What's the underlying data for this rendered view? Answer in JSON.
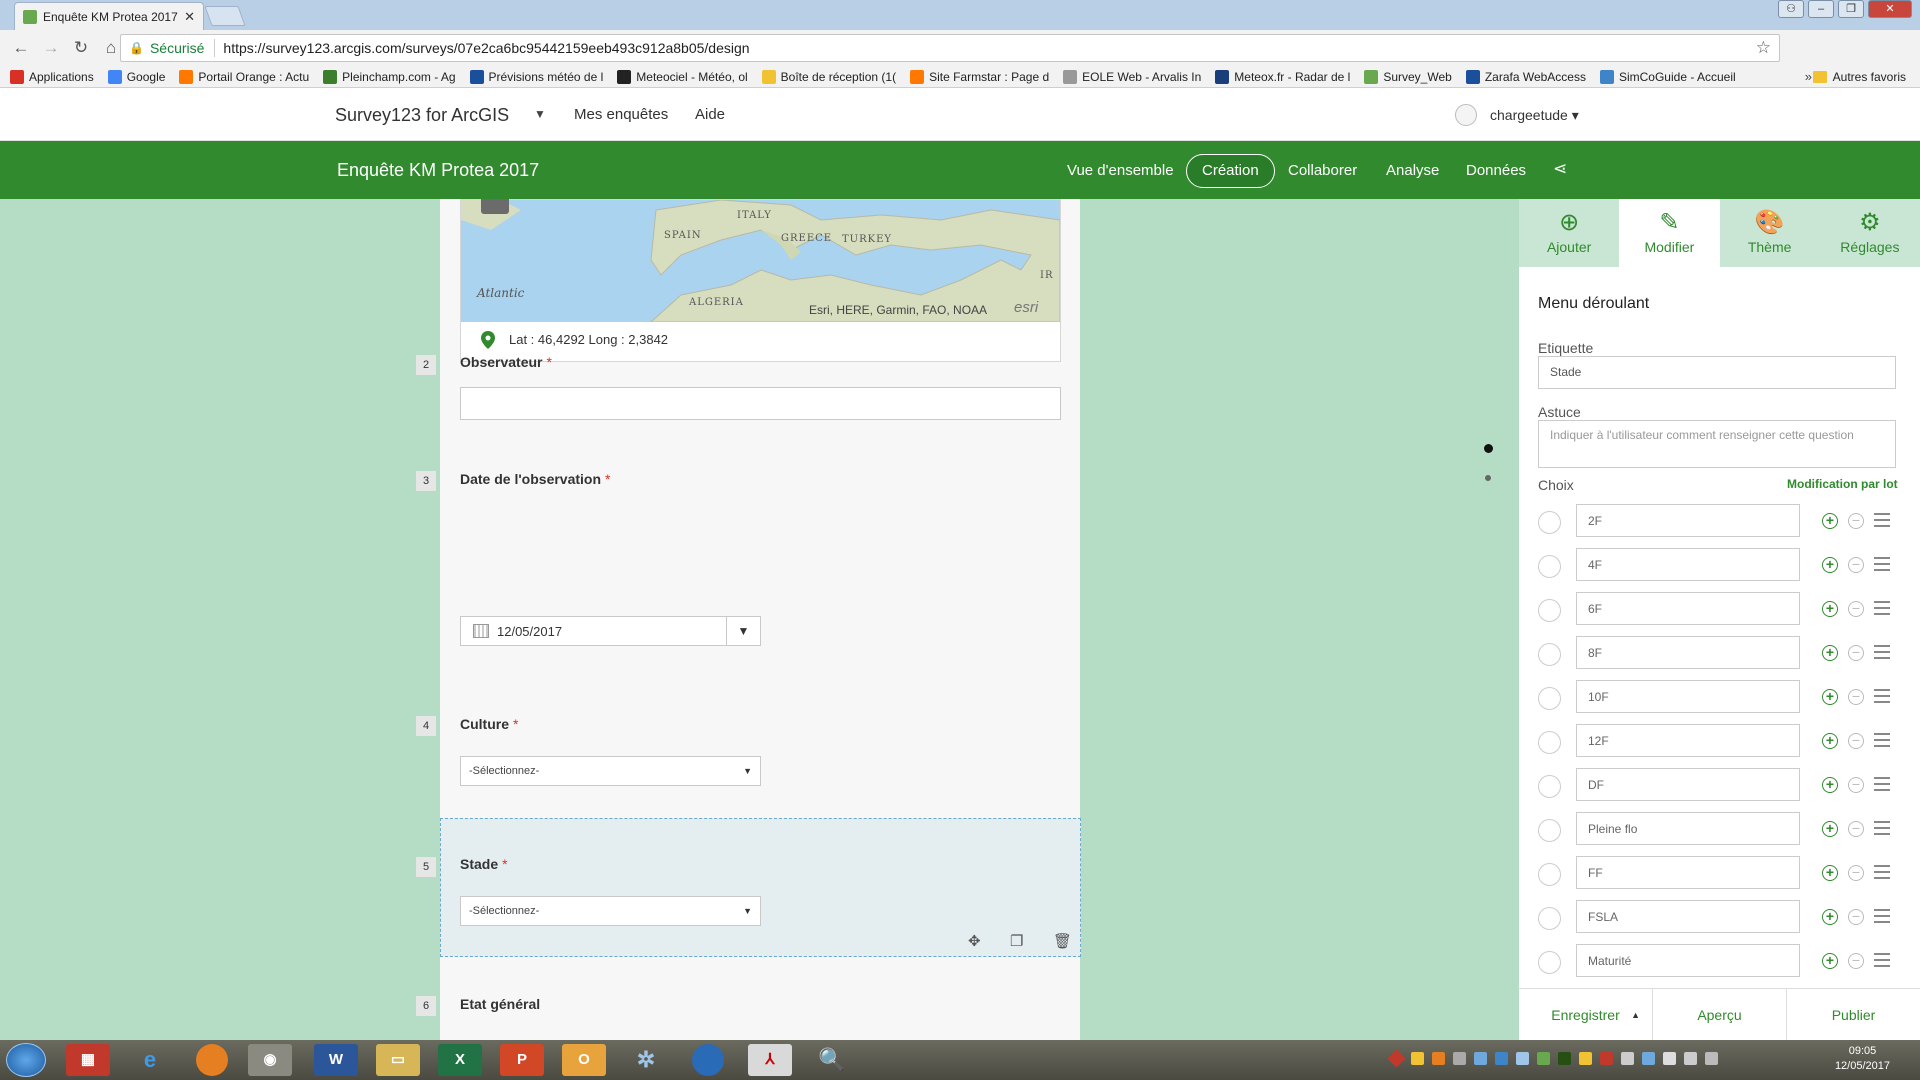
{
  "browser": {
    "tab_title": "Enquête KM Protea 2017",
    "secure_label": "Sécurisé",
    "url": "https://survey123.arcgis.com/surveys/07e2ca6bc95442159eeb493c912a8b05/design",
    "bookmarks": [
      {
        "label": "Applications",
        "color": "#d93025"
      },
      {
        "label": "Google",
        "color": "#4285f4"
      },
      {
        "label": "Portail Orange : Actu",
        "color": "#ff7900"
      },
      {
        "label": "Pleinchamp.com - Ag",
        "color": "#3b7f2d"
      },
      {
        "label": "Prévisions météo de l",
        "color": "#1a4f9c"
      },
      {
        "label": "Meteociel - Météo, ol",
        "color": "#222222"
      },
      {
        "label": "Boîte de réception (1(",
        "color": "#f1c232"
      },
      {
        "label": "Site Farmstar : Page d",
        "color": "#ff7900"
      },
      {
        "label": "EOLE Web - Arvalis In",
        "color": "#999999"
      },
      {
        "label": "Meteox.fr - Radar de l",
        "color": "#1a3e7a"
      },
      {
        "label": "Survey_Web",
        "color": "#6aa84f"
      },
      {
        "label": "Zarafa WebAccess",
        "color": "#1a4f9c"
      },
      {
        "label": "SimCoGuide - Accueil",
        "color": "#3d85c6"
      }
    ],
    "bookmarks_more": "»",
    "other_bookmarks": "Autres favoris"
  },
  "app_header": {
    "brand": "Survey123 for ArcGIS",
    "nav": [
      "Mes enquêtes",
      "Aide"
    ],
    "user": "chargeetude ▾"
  },
  "survey_bar": {
    "title": "Enquête KM Protea 2017",
    "tabs": [
      "Vue d'ensemble",
      "Création",
      "Collaborer",
      "Analyse",
      "Données"
    ],
    "active_tab": "Création"
  },
  "map": {
    "labels": [
      "ITALY",
      "SPAIN",
      "GREECE",
      "TURKEY",
      "Atlantic",
      "IR",
      "ALGERIA"
    ],
    "attribution": "Esri, HERE, Garmin, FAO, NOAA",
    "logo": "esri",
    "coords": "Lat : 46,4292 Long : 2,3842"
  },
  "questions": [
    {
      "num": "2",
      "label": "Observateur",
      "required": "*"
    },
    {
      "num": "3",
      "label": "Date de l'observation",
      "required": "*",
      "value": "12/05/2017"
    },
    {
      "num": "4",
      "label": "Culture",
      "required": "*",
      "placeholder": "-Sélectionnez-"
    },
    {
      "num": "5",
      "label": "Stade",
      "required": "*",
      "placeholder": "-Sélectionnez-"
    },
    {
      "num": "6",
      "label": "Etat général",
      "required": ""
    }
  ],
  "panel": {
    "tabs": [
      {
        "label": "Ajouter",
        "icon": "plus-circle-icon",
        "glyph": "⊕"
      },
      {
        "label": "Modifier",
        "icon": "pencil-icon",
        "glyph": "✎"
      },
      {
        "label": "Thème",
        "icon": "palette-icon",
        "glyph": "🎨"
      },
      {
        "label": "Réglages",
        "icon": "settings-icon",
        "glyph": "⚙"
      }
    ],
    "title": "Menu déroulant",
    "etiquette_label": "Etiquette",
    "etiquette_value": "Stade",
    "astuce_label": "Astuce",
    "astuce_placeholder": "Indiquer à l'utilisateur comment renseigner cette question",
    "choix_label": "Choix",
    "batch_label": "Modification par lot",
    "choices": [
      "2F",
      "4F",
      "6F",
      "8F",
      "10F",
      "12F",
      "DF",
      "Pleine flo",
      "FF",
      "FSLA",
      "Maturité"
    ]
  },
  "footer": {
    "save": "Enregistrer",
    "preview": "Aperçu",
    "publish": "Publier"
  },
  "taskbar": {
    "time": "09:05",
    "date": "12/05/2017"
  }
}
